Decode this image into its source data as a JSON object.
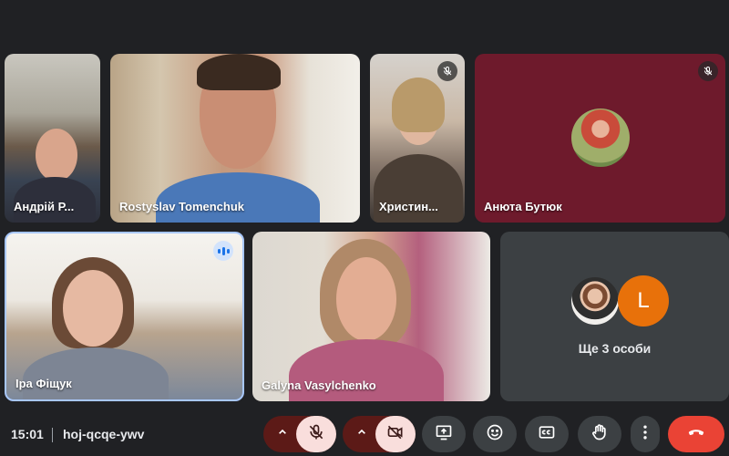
{
  "participants": [
    {
      "name": "Андрій Р...",
      "muted": false
    },
    {
      "name": "Rostyslav Tomenchuk",
      "muted": false
    },
    {
      "name": "Христин...",
      "muted": true
    },
    {
      "name": "Анюта Бутюк",
      "muted": true
    },
    {
      "name": "Іра Фіщук",
      "speaking": true
    },
    {
      "name": "Galyna Vasylchenko",
      "muted": false
    }
  ],
  "others_tile": {
    "label": "Ще 3 особи",
    "avatar_letter": "L",
    "avatar_letter_color": "#e8710a"
  },
  "bottom_bar": {
    "time": "15:01",
    "meeting_code": "hoj-qcqe-ywv",
    "buttons": [
      {
        "name": "mic-options",
        "icon": "chevron-up-icon"
      },
      {
        "name": "microphone",
        "icon": "mic-off-icon",
        "state": "off"
      },
      {
        "name": "camera-options",
        "icon": "chevron-up-icon"
      },
      {
        "name": "camera",
        "icon": "camera-off-icon",
        "state": "off"
      },
      {
        "name": "present",
        "icon": "present-screen-icon"
      },
      {
        "name": "reactions",
        "icon": "emoji-icon"
      },
      {
        "name": "captions",
        "icon": "captions-icon"
      },
      {
        "name": "raise-hand",
        "icon": "hand-icon"
      },
      {
        "name": "more-options",
        "icon": "more-vert-icon"
      },
      {
        "name": "leave-call",
        "icon": "end-call-icon"
      }
    ]
  },
  "colors": {
    "background": "#202124",
    "active_speaker_border": "#a8c7fa",
    "danger": "#ea4335",
    "off_button_bg": "#f9dedc"
  }
}
